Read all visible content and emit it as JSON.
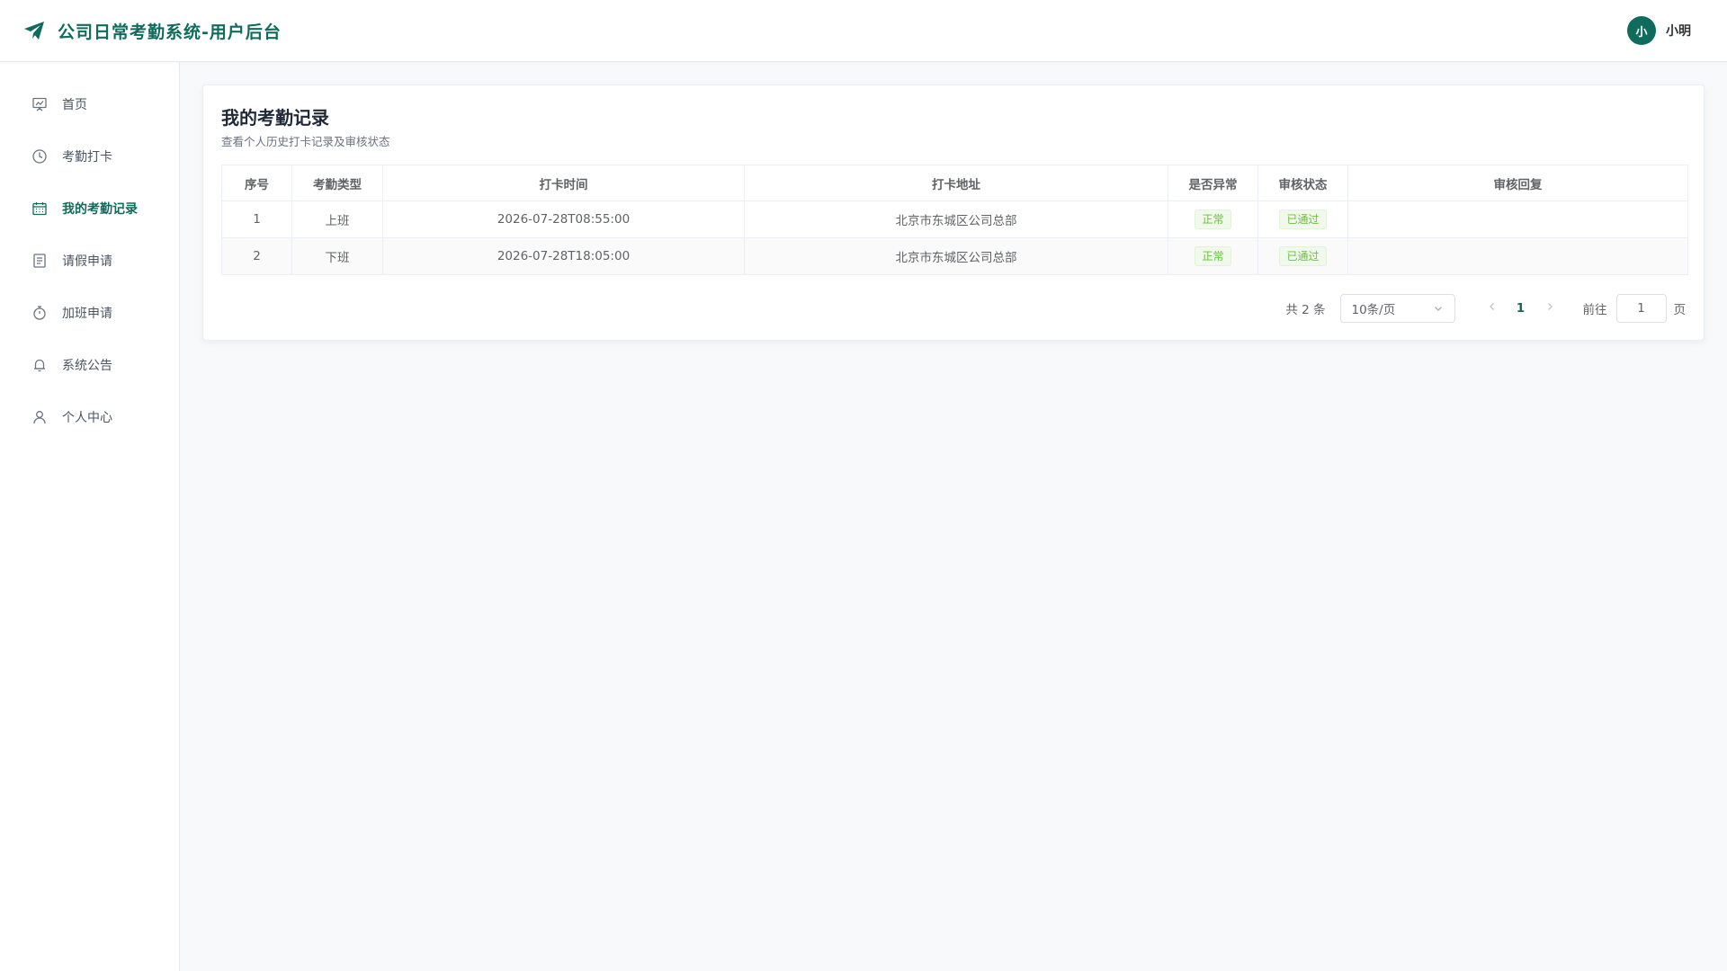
{
  "header": {
    "title": "公司日常考勤系统-用户后台",
    "avatar_text": "小",
    "username": "小明",
    "brand_color": "#0f6b5c"
  },
  "sidebar": {
    "items": [
      {
        "label": "首页",
        "icon": "presentation-icon",
        "active": false
      },
      {
        "label": "考勤打卡",
        "icon": "clock-icon",
        "active": false
      },
      {
        "label": "我的考勤记录",
        "icon": "calendar-icon",
        "active": true
      },
      {
        "label": "请假申请",
        "icon": "document-icon",
        "active": false
      },
      {
        "label": "加班申请",
        "icon": "stopwatch-icon",
        "active": false
      },
      {
        "label": "系统公告",
        "icon": "bell-icon",
        "active": false
      },
      {
        "label": "个人中心",
        "icon": "user-icon",
        "active": false
      }
    ]
  },
  "main": {
    "title": "我的考勤记录",
    "subtitle": "查看个人历史打卡记录及审核状态",
    "table": {
      "columns": [
        "序号",
        "考勤类型",
        "打卡时间",
        "打卡地址",
        "是否异常",
        "审核状态",
        "审核回复"
      ],
      "rows": [
        [
          "1",
          "上班",
          "2026-07-28T08:55:00",
          "北京市东城区公司总部",
          "正常",
          "已通过",
          ""
        ],
        [
          "2",
          "下班",
          "2026-07-28T18:05:00",
          "北京市东城区公司总部",
          "正常",
          "已通过",
          ""
        ]
      ]
    },
    "pagination": {
      "total_text": "共 2 条",
      "page_size": "10条/页",
      "current_page": "1",
      "goto_label": "前往",
      "goto_value": "1",
      "page_unit": "页"
    }
  }
}
